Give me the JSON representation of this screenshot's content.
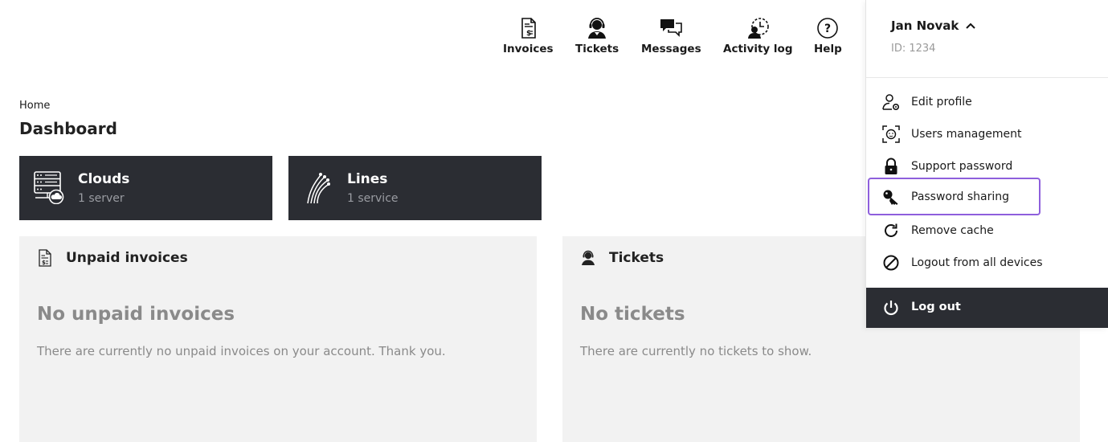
{
  "nav": {
    "invoices": "Invoices",
    "tickets": "Tickets",
    "messages": "Messages",
    "activity_log": "Activity log",
    "help": "Help"
  },
  "breadcrumb": "Home",
  "page_title": "Dashboard",
  "services": [
    {
      "name": "Clouds",
      "sub": "1 server",
      "icon": "server-cloud-icon"
    },
    {
      "name": "Lines",
      "sub": "1 service",
      "icon": "fiber-lines-icon"
    }
  ],
  "panels": {
    "invoices": {
      "title": "Unpaid invoices",
      "empty_title": "No unpaid invoices",
      "empty_text": "There are currently no unpaid invoices on your account. Thank you."
    },
    "tickets": {
      "title": "Tickets",
      "empty_title": "No tickets",
      "empty_text": "There are currently no tickets to show."
    }
  },
  "user": {
    "name": "Jan Novak",
    "id": "ID: 1234",
    "menu": {
      "edit_profile": "Edit profile",
      "users_management": "Users management",
      "support_password": "Support password",
      "password_sharing": "Password sharing",
      "remove_cache": "Remove cache",
      "logout_all": "Logout from all devices",
      "logout": "Log out"
    }
  },
  "colors": {
    "dark": "#2b2d33",
    "panel_bg": "#f2f2f2",
    "muted": "#8a8a8a",
    "highlight_outline": "#8e5fdc"
  }
}
